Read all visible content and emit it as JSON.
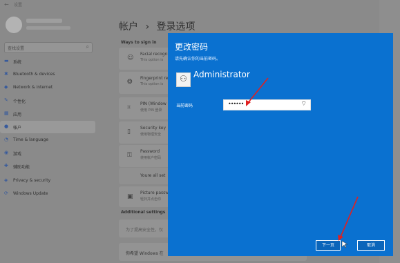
{
  "window": {
    "back_glyph": "←",
    "title": "设置"
  },
  "search": {
    "placeholder": "查找设置",
    "icon": "search-icon"
  },
  "sidebar": {
    "items": [
      {
        "label": "系统",
        "icon": "monitor-icon"
      },
      {
        "label": "Bluetooth & devices",
        "icon": "bluetooth-icon"
      },
      {
        "label": "Network & internet",
        "icon": "network-icon"
      },
      {
        "label": "个性化",
        "icon": "brush-icon"
      },
      {
        "label": "应用",
        "icon": "apps-icon"
      },
      {
        "label": "帐户",
        "icon": "account-icon"
      },
      {
        "label": "Time & language",
        "icon": "clock-icon"
      },
      {
        "label": "游戏",
        "icon": "game-icon"
      },
      {
        "label": "辅助功能",
        "icon": "accessibility-icon"
      },
      {
        "label": "Privacy & security",
        "icon": "shield-icon"
      },
      {
        "label": "Windows Update",
        "icon": "update-icon"
      }
    ]
  },
  "page": {
    "breadcrumb_parent": "帐户",
    "breadcrumb_sep": "›",
    "title": "登录选项",
    "section_label": "Ways to sign in",
    "cards": [
      {
        "title": "Facial recogni",
        "sub": "This option is",
        "icon": "face-icon"
      },
      {
        "title": "Fingerprint re",
        "sub": "This option is",
        "icon": "fingerprint-icon"
      },
      {
        "title": "PIN (Window",
        "sub": "使用 PIN 登录",
        "icon": "pin-icon"
      },
      {
        "title": "Security key",
        "sub": "使用物理安全",
        "icon": "key-icon"
      },
      {
        "title": "Password",
        "sub": "使用帐户密码",
        "icon": "password-icon"
      },
      {
        "title": "Youre all set",
        "sub": "",
        "icon": ""
      },
      {
        "title": "Picture passw",
        "sub": "轻扫并点击你",
        "icon": "picture-icon"
      }
    ],
    "additional_label": "Additional settings",
    "footer_text_1": "为了提高安全性，仅",
    "footer_text_2": "你希望 Windows 在"
  },
  "dialog": {
    "title": "更改密码",
    "subtitle": "请先确认你的当前密码。",
    "user_name": "Administrator",
    "password_label": "当前密码",
    "password_value": "••••••",
    "next_label": "下一页",
    "cancel_label": "取消",
    "accent_color": "#0a71d0"
  },
  "annotations": {
    "arrow_color": "#e02020"
  }
}
